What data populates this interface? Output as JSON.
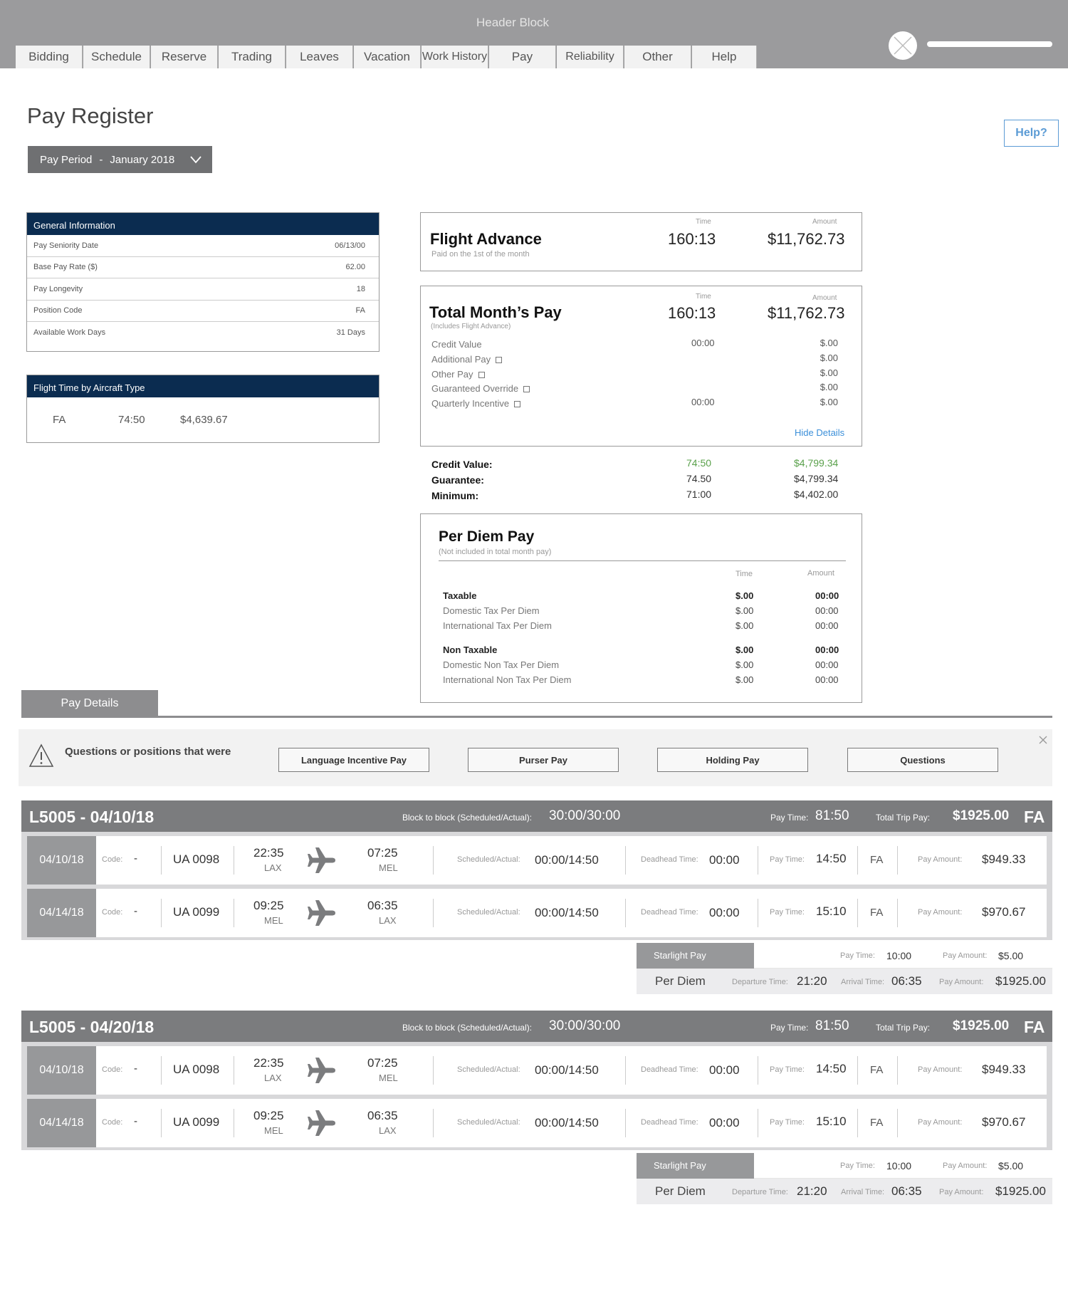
{
  "header": {
    "title": "Header Block",
    "tabs": [
      "Bidding",
      "Schedule",
      "Reserve",
      "Trading",
      "Leaves",
      "Vacation",
      "Work History",
      "Pay",
      "Reliability",
      "Other",
      "Help"
    ]
  },
  "page": {
    "title": "Pay Register",
    "period_label": "Pay Period",
    "period_sep": "-",
    "period_value": "January 2018",
    "help_label": "Help?"
  },
  "general_info": {
    "title": "General Information",
    "rows": [
      {
        "label": "Pay Seniority Date",
        "value": "06/13/00"
      },
      {
        "label": "Base Pay Rate ($)",
        "value": "62.00"
      },
      {
        "label": "Pay Longevity",
        "value": "18"
      },
      {
        "label": "Position Code",
        "value": "FA"
      },
      {
        "label": "Available Work Days",
        "value": "31 Days"
      }
    ]
  },
  "flight_time": {
    "title": "Flight Time by Aircraft Type",
    "type": "FA",
    "time": "74:50",
    "amount": "$4,639.67"
  },
  "flight_advance": {
    "title": "Flight Advance",
    "subtitle": "Paid on the 1st of the month",
    "time_label": "Time",
    "amount_label": "Amount",
    "time": "160:13",
    "amount": "$11,762.73"
  },
  "total_pay": {
    "title": "Total Month’s Pay",
    "subtitle": "(Includes Flight Advance)",
    "time_label": "Time",
    "amount_label": "Amount",
    "time": "160:13",
    "amount": "$11,762.73",
    "items": [
      {
        "label": "Credit Value",
        "time": "00:00",
        "amount": "$.00"
      },
      {
        "label": "Additional Pay",
        "time": "",
        "amount": "$.00"
      },
      {
        "label": "Other Pay",
        "time": "",
        "amount": "$.00"
      },
      {
        "label": "Guaranteed Override",
        "time": "",
        "amount": "$.00"
      },
      {
        "label": "Quarterly Incentive",
        "time": "00:00",
        "amount": "$.00"
      }
    ],
    "hide_details": "Hide Details"
  },
  "summary": [
    {
      "label": "Credit Value:",
      "time": "74:50",
      "amount": "$4,799.34"
    },
    {
      "label": "Guarantee:",
      "time": "74.50",
      "amount": "$4,799.34"
    },
    {
      "label": "Minimum:",
      "time": "71:00",
      "amount": "$4,402.00"
    }
  ],
  "summary_highlight_color": "#5aa14b",
  "per_diem": {
    "title": "Per Diem Pay",
    "subtitle": "(Not included in total month pay)",
    "time_label": "Time",
    "amount_label": "Amount",
    "taxable": {
      "label": "Taxable",
      "time": "$.00",
      "amount": "00:00"
    },
    "taxable_rows": [
      {
        "label": "Domestic Tax Per Diem",
        "time": "$.00",
        "amount": "00:00"
      },
      {
        "label": "International Tax Per Diem",
        "time": "$.00",
        "amount": "00:00"
      }
    ],
    "non_taxable": {
      "label": "Non Taxable",
      "time": "$.00",
      "amount": "00:00"
    },
    "non_taxable_rows": [
      {
        "label": "Domestic Non Tax Per Diem",
        "time": "$.00",
        "amount": "00:00"
      },
      {
        "label": "International Non Tax Per Diem",
        "time": "$.00",
        "amount": "00:00"
      }
    ]
  },
  "pay_details": {
    "tab_label": "Pay Details",
    "notice_text": "Questions or positions that were",
    "buttons": [
      "Language Incentive Pay",
      "Purser Pay",
      "Holding Pay",
      "Questions"
    ]
  },
  "trip_labels": {
    "block": "Block to block (Scheduled/Actual):",
    "pay_time": "Pay Time:",
    "total_trip_pay": "Total Trip Pay:",
    "code": "Code:",
    "scheduled_actual": "Scheduled/Actual:",
    "deadhead": "Deadhead Time:",
    "pay_amount": "Pay Amount:",
    "starlight": "Starlight Pay",
    "per_diem": "Per Diem",
    "departure": "Departure Time:",
    "arrival": "Arrival Time:"
  },
  "trips": [
    {
      "title": "L5005 - 04/10/18",
      "block": "30:00/30:00",
      "pay_time": "81:50",
      "total_trip_pay": "$1925.00",
      "position": "FA",
      "legs": [
        {
          "date": "04/10/18",
          "code": "-",
          "flight": "UA 0098",
          "dep_time": "22:35",
          "dep": "LAX",
          "arr_time": "07:25",
          "arr": "MEL",
          "sched": "00:00/14:50",
          "deadhead": "00:00",
          "pay_time": "14:50",
          "pos": "FA",
          "pay_amount": "$949.33"
        },
        {
          "date": "04/14/18",
          "code": "-",
          "flight": "UA 0099",
          "dep_time": "09:25",
          "dep": "MEL",
          "arr_time": "06:35",
          "arr": "LAX",
          "sched": "00:00/14:50",
          "deadhead": "00:00",
          "pay_time": "15:10",
          "pos": "FA",
          "pay_amount": "$970.67"
        }
      ],
      "starlight": {
        "pay_time": "10:00",
        "pay_amount": "$5.00"
      },
      "per_diem": {
        "departure": "21:20",
        "arrival": "06:35",
        "pay_amount": "$1925.00"
      }
    },
    {
      "title": "L5005 - 04/20/18",
      "block": "30:00/30:00",
      "pay_time": "81:50",
      "total_trip_pay": "$1925.00",
      "position": "FA",
      "legs": [
        {
          "date": "04/10/18",
          "code": "-",
          "flight": "UA 0098",
          "dep_time": "22:35",
          "dep": "LAX",
          "arr_time": "07:25",
          "arr": "MEL",
          "sched": "00:00/14:50",
          "deadhead": "00:00",
          "pay_time": "14:50",
          "pos": "FA",
          "pay_amount": "$949.33"
        },
        {
          "date": "04/14/18",
          "code": "-",
          "flight": "UA 0099",
          "dep_time": "09:25",
          "dep": "MEL",
          "arr_time": "06:35",
          "arr": "LAX",
          "sched": "00:00/14:50",
          "deadhead": "00:00",
          "pay_time": "15:10",
          "pos": "FA",
          "pay_amount": "$970.67"
        }
      ],
      "starlight": {
        "pay_time": "10:00",
        "pay_amount": "$5.00"
      },
      "per_diem": {
        "departure": "21:20",
        "arrival": "06:35",
        "pay_amount": "$1925.00"
      }
    }
  ],
  "icons": {
    "plane": "plane-icon",
    "warning": "warning-icon",
    "close": "close-icon",
    "chevron": "chevron-down-icon"
  }
}
